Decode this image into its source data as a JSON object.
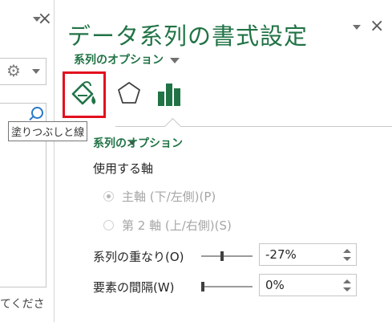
{
  "left_pane": {
    "close_label": "×",
    "gear_icon": "gear-icon",
    "search_icon": "search-icon",
    "hint_text": "てくださ"
  },
  "panel": {
    "title": "データ系列の書式設定",
    "close_label": "×",
    "options_menu_label": "系列のオプション",
    "tabs": [
      {
        "name": "fill-line",
        "icon": "paint-bucket-icon",
        "selected": true
      },
      {
        "name": "effects",
        "icon": "pentagon-icon",
        "selected": false
      },
      {
        "name": "series-options",
        "icon": "bar-chart-icon",
        "selected": false
      }
    ],
    "tooltip": "塗りつぶしと線",
    "section_title": "系列のオプション",
    "axis_label": "使用する軸",
    "primary_axis_label": "主軸 (下/左側)(P)",
    "secondary_axis_label": "第 2 軸 (上/右側)(S)",
    "overlap_label": "系列の重なり(O)",
    "overlap_value": "-27%",
    "gap_label": "要素の間隔(W)",
    "gap_value": "0%",
    "accent_color": "#217346",
    "highlight_color": "#e3101e"
  }
}
